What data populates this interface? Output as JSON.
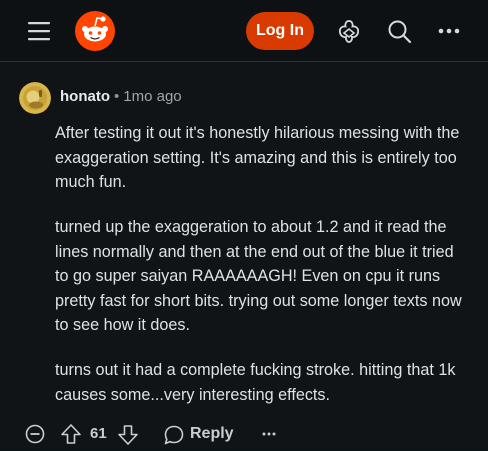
{
  "header": {
    "login_label": "Log In",
    "icons": [
      "menu-icon",
      "reddit-logo",
      "achievements-icon",
      "search-icon",
      "more-icon"
    ],
    "accent_color": "#d93a00"
  },
  "comment": {
    "author": "honato",
    "separator": "•",
    "time": "1mo ago",
    "paragraphs": [
      "After testing it out it's honestly hilarious messing with the exaggeration setting. It's amazing and this is entirely too much fun.",
      "turned up the exaggeration to about 1.2 and it read the lines normally and then at the end out of the blue it tried to go super saiyan RAAAAAAGH! Even on cpu it runs pretty fast for short bits. trying out some longer texts now to see how it does.",
      "turns out it had a complete fucking stroke. hitting that 1k causes some...very interesting effects."
    ],
    "actions": {
      "score": "61",
      "reply_label": "Reply",
      "more_label": "•••"
    }
  }
}
